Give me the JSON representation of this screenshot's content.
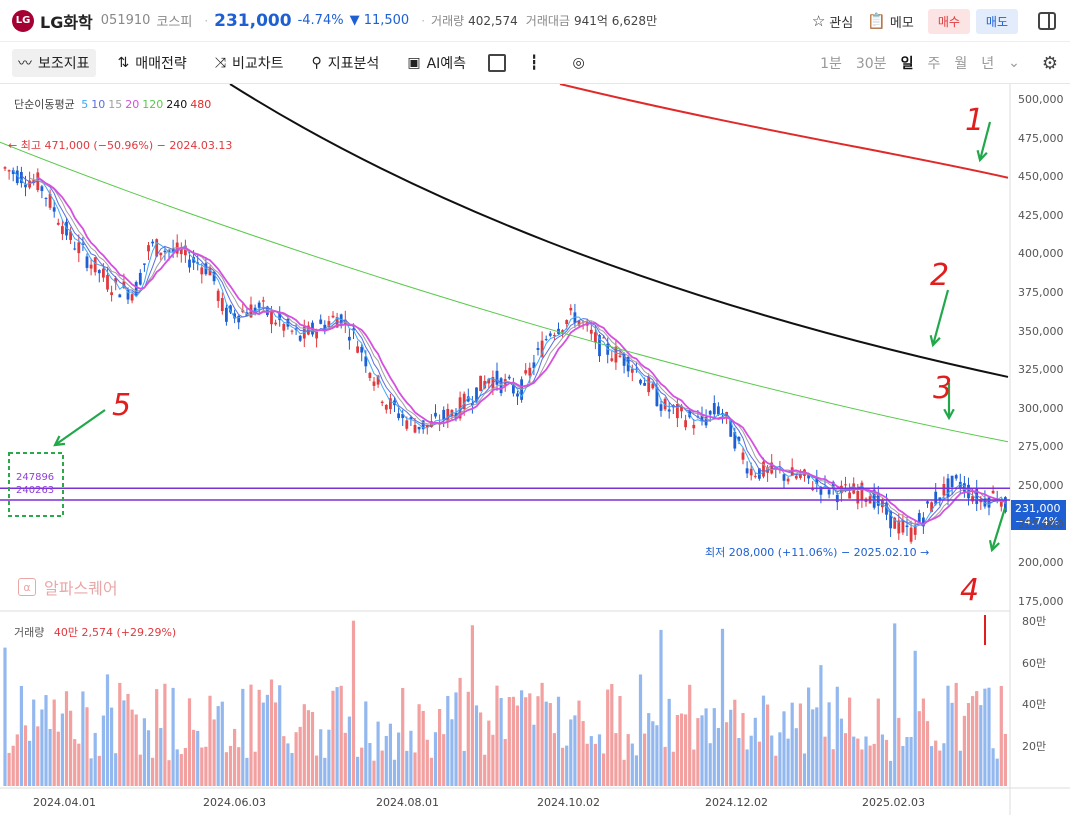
{
  "header": {
    "logo_text": "LG",
    "name": "LG화학",
    "code": "051910",
    "market": "코스피",
    "price": "231,000",
    "change_pct": "-4.74%",
    "change": "▼ 11,500",
    "volume_label": "거래량",
    "volume": "402,574",
    "amount_label": "거래대금",
    "amount": "941억 6,628만",
    "watch_label": "관심",
    "memo_label": "메모",
    "buy_label": "매수",
    "sell_label": "매도"
  },
  "toolbar": {
    "indicators_label": "보조지표",
    "strategy_label": "매매전략",
    "compare_label": "비교차트",
    "analysis_label": "지표분석",
    "ai_label": "AI예측",
    "periods": [
      "1분",
      "30분",
      "일",
      "주",
      "월",
      "년"
    ],
    "active_period": "일"
  },
  "chart": {
    "ma_legend_title": "단순이동평균",
    "ma_periods": [
      {
        "label": "5",
        "color": "#3fa9f5"
      },
      {
        "label": "10",
        "color": "#5a6ee0"
      },
      {
        "label": "15",
        "color": "#a0a0a0"
      },
      {
        "label": "20",
        "color": "#d64fe0"
      },
      {
        "label": "120",
        "color": "#58c94a"
      },
      {
        "label": "240",
        "color": "#111111"
      },
      {
        "label": "480",
        "color": "#e02a2a"
      }
    ],
    "high_label": "← 최고 471,000 (−50.96%) − 2024.03.13",
    "low_label": "최저 208,000 (+11.06%) − 2025.02.10 →",
    "watermark": "알파스퀘어",
    "level_1": "247896",
    "level_2": "240263",
    "price_tag_price": "231,000",
    "price_tag_pct": "−4.74%",
    "y_ticks": [
      "500,000",
      "475,000",
      "450,000",
      "425,000",
      "400,000",
      "375,000",
      "350,000",
      "325,000",
      "300,000",
      "275,000",
      "250,000",
      "225,000",
      "200,000",
      "175,000"
    ],
    "vol_ticks": [
      "80만",
      "60만",
      "40만",
      "20만"
    ],
    "vol_legend_label": "거래량",
    "vol_legend_value": "40만 2,574 (+29.29%)",
    "x_ticks": [
      "2024.04.01",
      "2024.06.03",
      "2024.08.01",
      "2024.10.02",
      "2024.12.02",
      "2025.02.03"
    ],
    "annotations": [
      "1",
      "2",
      "3",
      "4",
      "5"
    ],
    "up_color": "#e0393e",
    "down_color": "#1e60d4"
  }
}
